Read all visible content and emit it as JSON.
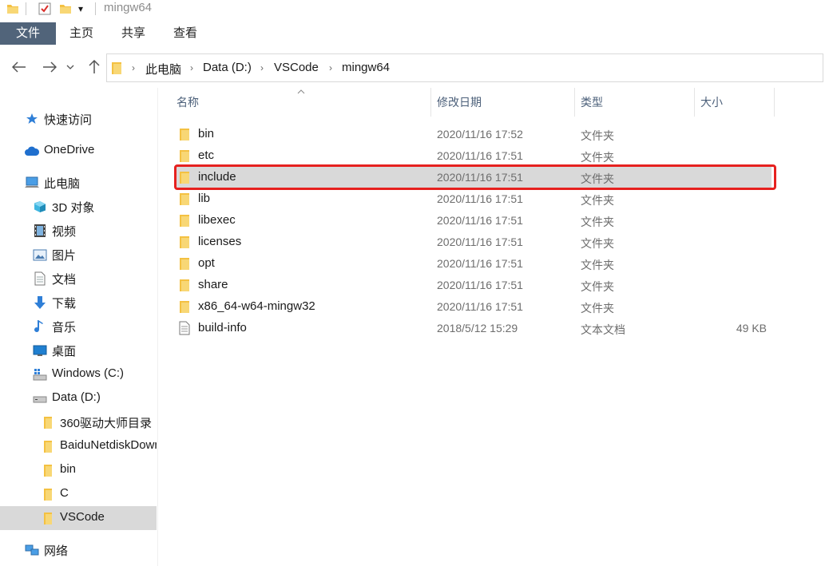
{
  "titlebar": {
    "title": "mingw64",
    "qa_dropdown": "▾"
  },
  "ribbon": {
    "tabs": [
      "文件",
      "主页",
      "共享",
      "查看"
    ]
  },
  "nav": {
    "crumbs": [
      "此电脑",
      "Data (D:)",
      "VSCode",
      "mingw64"
    ]
  },
  "sidebar": {
    "items": [
      {
        "label": "快速访问",
        "icon": "star-icon"
      },
      {
        "label": "OneDrive",
        "icon": "cloud-icon"
      },
      {
        "label": "此电脑",
        "icon": "computer-icon"
      },
      {
        "label": "3D 对象",
        "icon": "cube-icon"
      },
      {
        "label": "视频",
        "icon": "video-icon"
      },
      {
        "label": "图片",
        "icon": "picture-icon"
      },
      {
        "label": "文档",
        "icon": "document-icon"
      },
      {
        "label": "下载",
        "icon": "download-icon"
      },
      {
        "label": "音乐",
        "icon": "music-icon"
      },
      {
        "label": "桌面",
        "icon": "desktop-icon"
      },
      {
        "label": "Windows (C:)",
        "icon": "windows-drive-icon"
      },
      {
        "label": "Data (D:)",
        "icon": "drive-icon"
      },
      {
        "label": "360驱动大师目录",
        "icon": "folder-icon"
      },
      {
        "label": "BaiduNetdiskDownload",
        "icon": "folder-icon"
      },
      {
        "label": "bin",
        "icon": "folder-icon"
      },
      {
        "label": "C",
        "icon": "folder-icon"
      },
      {
        "label": "VSCode",
        "icon": "folder-icon",
        "selected": true
      },
      {
        "label": "网络",
        "icon": "network-icon"
      }
    ]
  },
  "columns": {
    "name": "名称",
    "modified": "修改日期",
    "type": "类型",
    "size": "大小"
  },
  "files": [
    {
      "name": "bin",
      "modified": "2020/11/16 17:52",
      "type": "文件夹",
      "size": "",
      "icon": "folder-icon"
    },
    {
      "name": "etc",
      "modified": "2020/11/16 17:51",
      "type": "文件夹",
      "size": "",
      "icon": "folder-icon"
    },
    {
      "name": "include",
      "modified": "2020/11/16 17:51",
      "type": "文件夹",
      "size": "",
      "icon": "folder-icon",
      "selected": true
    },
    {
      "name": "lib",
      "modified": "2020/11/16 17:51",
      "type": "文件夹",
      "size": "",
      "icon": "folder-icon"
    },
    {
      "name": "libexec",
      "modified": "2020/11/16 17:51",
      "type": "文件夹",
      "size": "",
      "icon": "folder-icon"
    },
    {
      "name": "licenses",
      "modified": "2020/11/16 17:51",
      "type": "文件夹",
      "size": "",
      "icon": "folder-icon"
    },
    {
      "name": "opt",
      "modified": "2020/11/16 17:51",
      "type": "文件夹",
      "size": "",
      "icon": "folder-icon"
    },
    {
      "name": "share",
      "modified": "2020/11/16 17:51",
      "type": "文件夹",
      "size": "",
      "icon": "folder-icon"
    },
    {
      "name": "x86_64-w64-mingw32",
      "modified": "2020/11/16 17:51",
      "type": "文件夹",
      "size": "",
      "icon": "folder-icon"
    },
    {
      "name": "build-info",
      "modified": "2018/5/12 15:29",
      "type": "文本文档",
      "size": "49 KB",
      "icon": "text-file-icon"
    }
  ],
  "colors": {
    "accent": "#51647a",
    "selection": "#d9d9d9",
    "highlight": "#e6211f",
    "folder": "#f4c142"
  }
}
